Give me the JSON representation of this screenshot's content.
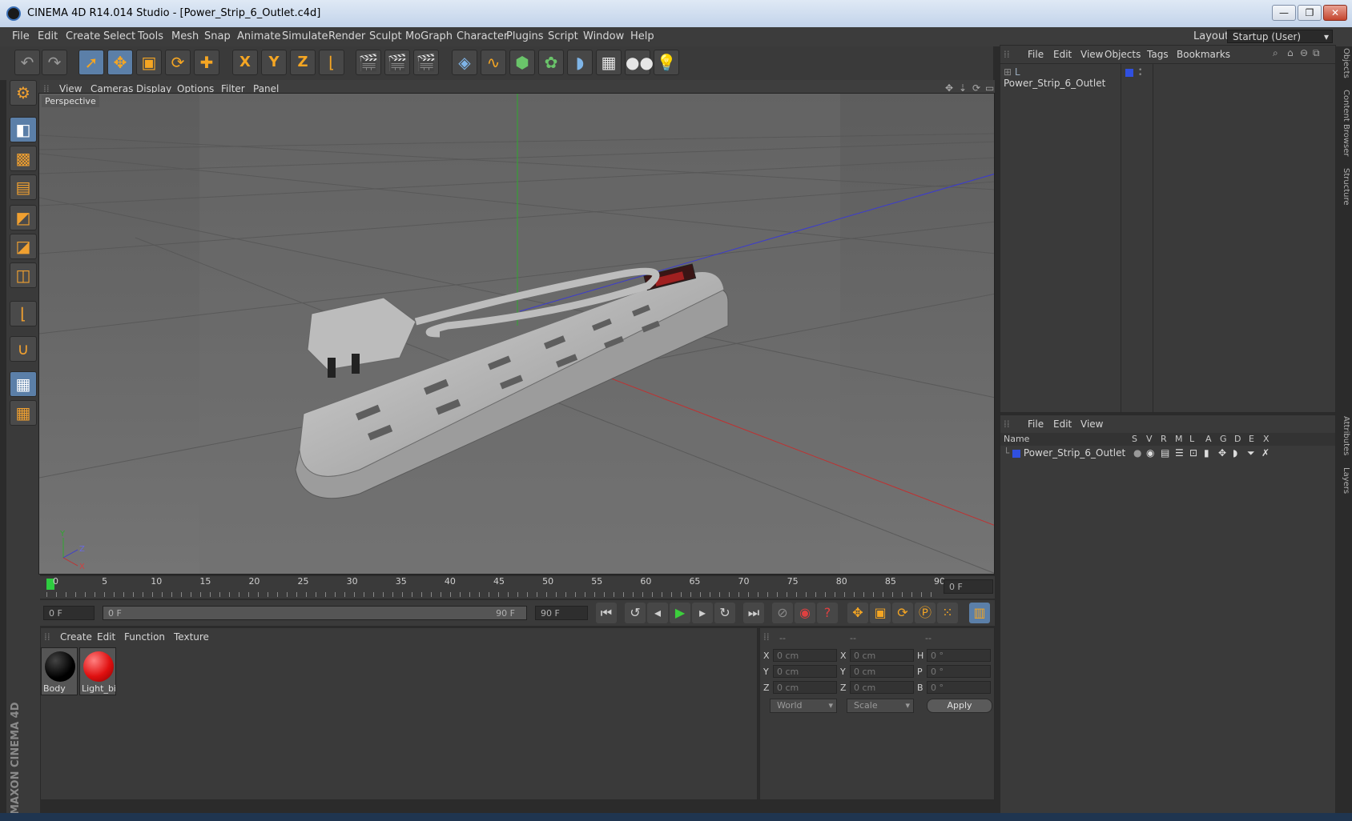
{
  "window": {
    "title": "CINEMA 4D R14.014 Studio - [Power_Strip_6_Outlet.c4d]",
    "minimize": "—",
    "restore": "❐",
    "close": "✕"
  },
  "menubar": {
    "items": [
      "File",
      "Edit",
      "Create",
      "Select",
      "Tools",
      "Mesh",
      "Snap",
      "Animate",
      "Simulate",
      "Render",
      "Sculpt",
      "MoGraph",
      "Character",
      "Plugins",
      "Script",
      "Window",
      "Help"
    ],
    "layout_label": "Layout:",
    "layout_value": "Startup (User)"
  },
  "toolbar": {
    "axis_x": "X",
    "axis_y": "Y",
    "axis_z": "Z"
  },
  "viewport": {
    "menu": [
      "View",
      "Cameras",
      "Display",
      "Options",
      "Filter",
      "Panel"
    ],
    "label": "Perspective",
    "axis_y": "Y",
    "axis_z": "Z",
    "axis_x": "X"
  },
  "timeline": {
    "ticks": [
      "0",
      "5",
      "10",
      "15",
      "20",
      "25",
      "30",
      "35",
      "40",
      "45",
      "50",
      "55",
      "60",
      "65",
      "70",
      "75",
      "80",
      "85",
      "90"
    ],
    "current_frame": "0 F",
    "start_field": "0 F",
    "range_start": "0 F",
    "range_end": "90 F",
    "end_field": "90 F"
  },
  "materials": {
    "menu": [
      "Create",
      "Edit",
      "Function",
      "Texture"
    ],
    "items": [
      {
        "name": "Body",
        "color": "#050505"
      },
      {
        "name": "Light_bi",
        "color": "#e01010"
      }
    ]
  },
  "coords": {
    "headers": [
      "--",
      "--",
      "--"
    ],
    "rows": [
      {
        "l1": "X",
        "v1": "0 cm",
        "l2": "X",
        "v2": "0 cm",
        "l3": "H",
        "v3": "0 °"
      },
      {
        "l1": "Y",
        "v1": "0 cm",
        "l2": "Y",
        "v2": "0 cm",
        "l3": "P",
        "v3": "0 °"
      },
      {
        "l1": "Z",
        "v1": "0 cm",
        "l2": "Z",
        "v2": "0 cm",
        "l3": "B",
        "v3": "0 °"
      }
    ],
    "world": "World",
    "scale": "Scale",
    "apply": "Apply"
  },
  "objects": {
    "menu": [
      "File",
      "Edit",
      "View",
      "Objects",
      "Tags",
      "Bookmarks"
    ],
    "item": "Power_Strip_6_Outlet"
  },
  "layers": {
    "menu": [
      "File",
      "Edit",
      "View"
    ],
    "name_header": "Name",
    "col_headers": [
      "S",
      "V",
      "R",
      "M",
      "L",
      "A",
      "G",
      "D",
      "E",
      "X"
    ],
    "item": "Power_Strip_6_Outlet"
  },
  "sidetabs": {
    "objects": "Objects",
    "content_browser": "Content Browser",
    "structure": "Structure",
    "attributes": "Attributes",
    "layers": "Layers"
  },
  "branding": "MAXON CINEMA 4D"
}
